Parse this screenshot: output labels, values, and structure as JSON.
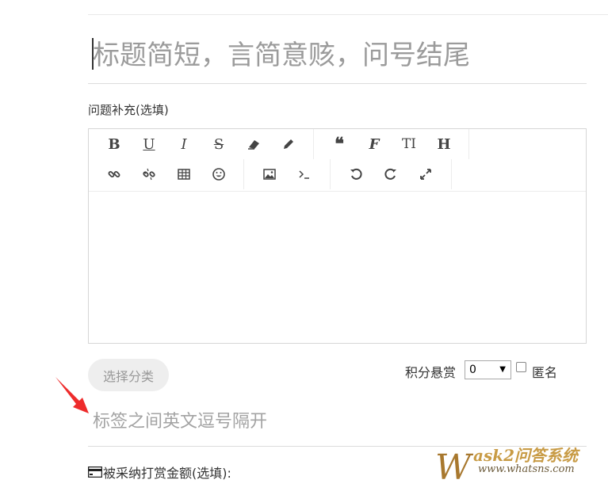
{
  "title": {
    "placeholder": "标题简短，言简意赅，问号结尾"
  },
  "supplement": {
    "label": "问题补充(选填)"
  },
  "editor": {
    "toolbar_row1": [
      {
        "glyph": "B",
        "icon": "bold-icon"
      },
      {
        "glyph": "U",
        "icon": "underline-icon"
      },
      {
        "glyph": "I",
        "icon": "italic-icon"
      },
      {
        "glyph": "S",
        "icon": "strikethrough-icon"
      },
      {
        "glyph": "",
        "icon": "eraser-icon"
      },
      {
        "glyph": "",
        "icon": "pencil-icon"
      },
      {
        "glyph": "❝",
        "icon": "quote-icon"
      },
      {
        "glyph": "F",
        "icon": "font-icon"
      },
      {
        "glyph": "TI",
        "icon": "font-size-icon"
      },
      {
        "glyph": "H",
        "icon": "heading-icon"
      }
    ],
    "toolbar_row2": [
      {
        "icon": "link-icon"
      },
      {
        "icon": "unlink-icon"
      },
      {
        "icon": "table-icon"
      },
      {
        "icon": "emoji-icon"
      },
      {
        "icon": "image-icon"
      },
      {
        "icon": "code-icon"
      },
      {
        "icon": "undo-icon"
      },
      {
        "icon": "redo-icon"
      },
      {
        "icon": "fullscreen-icon"
      }
    ]
  },
  "category": {
    "button_label": "选择分类"
  },
  "bounty": {
    "label": "积分悬赏",
    "selected": "0",
    "anonymous_label": "匿名"
  },
  "tags": {
    "placeholder": "标签之间英文逗号隔开"
  },
  "reward": {
    "label": "被采纳打赏金额(选填):"
  },
  "watermark": {
    "title": "ask2问答系统",
    "url": "www.whatsns.com",
    "initial": "W"
  }
}
